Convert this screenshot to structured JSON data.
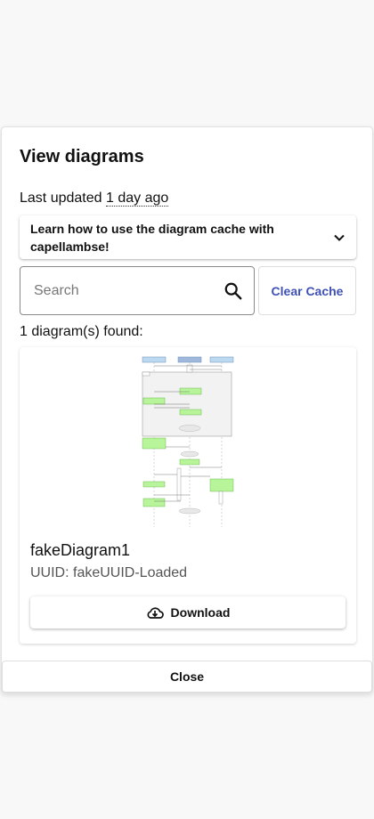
{
  "dialog": {
    "title": "View diagrams",
    "last_updated_prefix": "Last updated",
    "last_updated_value": "1 day ago",
    "expander_text": "Learn how to use the diagram cache with capellambse!",
    "search": {
      "placeholder": "Search",
      "value": ""
    },
    "clear_cache_label": "Clear Cache",
    "found_text": "1 diagram(s) found:",
    "diagrams": [
      {
        "name": "fakeDiagram1",
        "uuid_text": "UUID: fakeUUID-Loaded",
        "download_label": "Download"
      }
    ],
    "close_label": "Close"
  },
  "colors": {
    "accent": "#3f51b5",
    "background": "#f8f8f8",
    "diagram_green": "#b8f59a",
    "diagram_blue": "#bcd9f2"
  },
  "icons": [
    "chevron-down-icon",
    "search-icon",
    "cloud-download-icon"
  ]
}
